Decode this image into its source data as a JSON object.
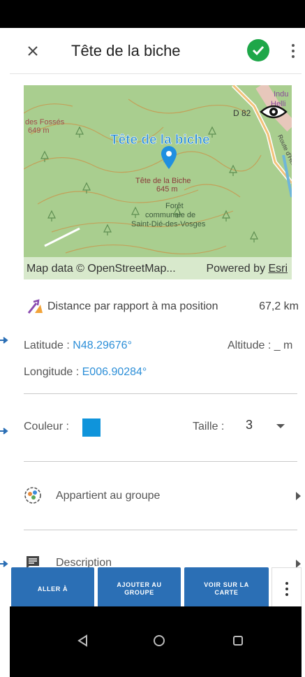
{
  "app_bar": {
    "title": "Tête de la biche",
    "close_icon": "close-icon",
    "confirm_icon": "check-circle-icon",
    "menu_icon": "more-vert-icon"
  },
  "map": {
    "place_label": "Tête de la biche",
    "marker_label": "Tête de la Biche",
    "marker_elevation": "645 m",
    "forest_label_1": "Forêt",
    "forest_label_2": "communale de",
    "forest_label_3": "Saint-Dié-des-Vosges",
    "left_label_1": "des Fossés",
    "left_label_2": "649 m",
    "road_label": "D 82",
    "road_label_2": "Route d'Herbaville",
    "top_right_label_1": "Indu",
    "top_right_label_2": "Helli",
    "credit": "Map data © OpenStreetMap...",
    "powered_prefix": "Powered by ",
    "powered_brand": "Esri",
    "eye_icon": "eye-icon"
  },
  "distance": {
    "label": "Distance par rapport à ma position",
    "value": "67,2 km",
    "icon": "route-arrow-icon"
  },
  "coordinates": {
    "latitude_label": "Latitude : ",
    "latitude_value": "N48.29676°",
    "longitude_label": "Longitude : ",
    "longitude_value": "E006.90284°",
    "altitude_label": "Altitude : _ m"
  },
  "style": {
    "color_label": "Couleur :",
    "color_value": "#0f94db",
    "size_label": "Taille :",
    "size_value": "3"
  },
  "rows": {
    "group_label": "Appartient au groupe",
    "group_icon": "group-icon",
    "description_label": "Description",
    "description_icon": "comment-icon"
  },
  "actions": {
    "go_to": "ALLER À",
    "add_to_group_1": "AJOUTER AU",
    "add_to_group_2": "GROUPE",
    "view_on_map_1": "VOIR SUR LA",
    "view_on_map_2": "CARTE"
  },
  "colors": {
    "accent": "#2d8fd8",
    "button_bg": "#2b6fb5",
    "confirm": "#1ea749"
  }
}
